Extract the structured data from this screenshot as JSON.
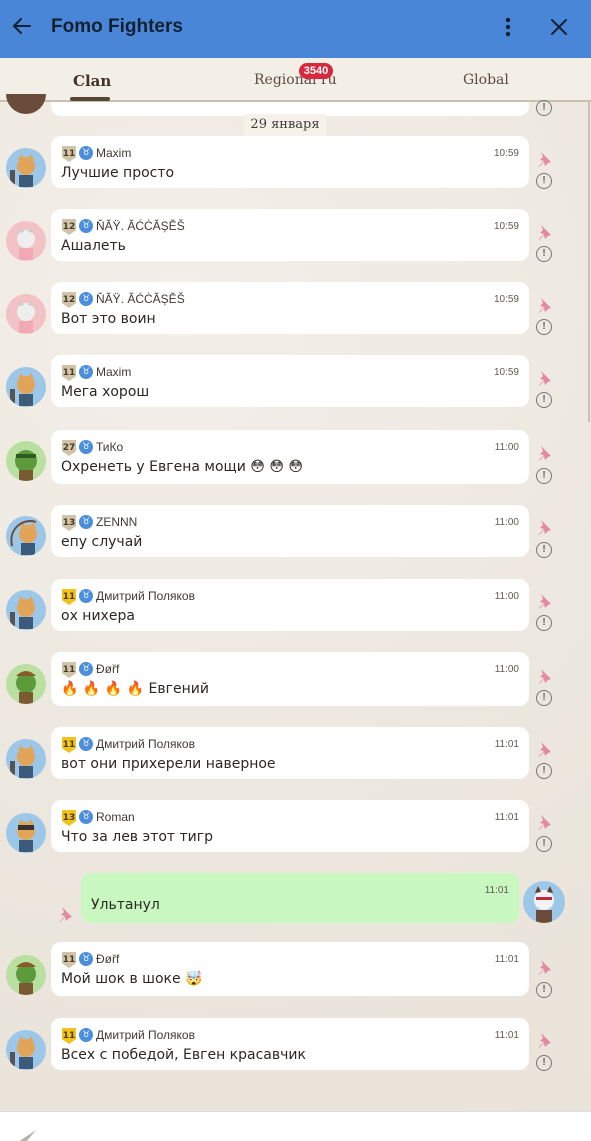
{
  "header": {
    "title": "Fomo Fighters"
  },
  "tabs": [
    {
      "label": "Clan",
      "active": true
    },
    {
      "label": "Regional ru",
      "badge": "3540"
    },
    {
      "label": "Global"
    }
  ],
  "date_separator": "29 января",
  "messages": [
    {
      "rank": "11",
      "rank_style": "gray",
      "name": "Maxim",
      "time": "10:59",
      "text": "Лучшие просто",
      "avatar": "cat-warrior-blue"
    },
    {
      "rank": "12",
      "rank_style": "gray",
      "name": "ŇĂŸ. ĂĆĊĂȘĚŠ",
      "time": "10:59",
      "text": "Ашалеть",
      "avatar": "cat-pink"
    },
    {
      "rank": "12",
      "rank_style": "gray",
      "name": "ŇĂŸ. ĂĆĊĂȘĚŠ",
      "time": "10:59",
      "text": "Вот это воин",
      "avatar": "cat-pink"
    },
    {
      "rank": "11",
      "rank_style": "gray",
      "name": "Maxim",
      "time": "10:59",
      "text": "Мега хорош",
      "avatar": "cat-warrior-blue"
    },
    {
      "rank": "27",
      "rank_style": "gray",
      "name": "ТиКо",
      "time": "11:00",
      "text": "Охренеть у Евгена мощи 😳 😳 😳",
      "avatar": "frog-green"
    },
    {
      "rank": "13",
      "rank_style": "gray",
      "name": "ZENNN",
      "time": "11:00",
      "text": "епу случай",
      "avatar": "cat-whip"
    },
    {
      "rank": "11",
      "rank_style": "gold",
      "name": "Дмитрий Поляков",
      "time": "11:00",
      "text": "ох нихера",
      "avatar": "cat-warrior-blue"
    },
    {
      "rank": "11",
      "rank_style": "gray",
      "name": "Ðøřf",
      "time": "11:00",
      "text": "🔥 🔥 🔥 🔥 Евгений",
      "avatar": "frog-warrior"
    },
    {
      "rank": "11",
      "rank_style": "gold",
      "name": "Дмитрий Поляков",
      "time": "11:01",
      "text": "вот они прихерели наверное",
      "avatar": "cat-warrior-blue"
    },
    {
      "rank": "13",
      "rank_style": "gold",
      "name": "Roman",
      "time": "11:01",
      "text": "Что за лев этот тигр",
      "avatar": "cat-goggles"
    },
    {
      "own": true,
      "time": "11:01",
      "text": "Ультанул",
      "avatar": "cat-red-warrior"
    },
    {
      "rank": "11",
      "rank_style": "gray",
      "name": "Ðøřf",
      "time": "11:01",
      "text": "Мой шок в шоке 🤯",
      "avatar": "frog-warrior"
    },
    {
      "rank": "11",
      "rank_style": "gold",
      "name": "Дмитрий Поляков",
      "time": "11:01",
      "text": "Всех с победой, Евген красавчик",
      "avatar": "cat-warrior-blue"
    }
  ],
  "colors": {
    "header": "#4a86d8",
    "own_bubble": "#c8f7c0",
    "badge": "#d8283d"
  }
}
